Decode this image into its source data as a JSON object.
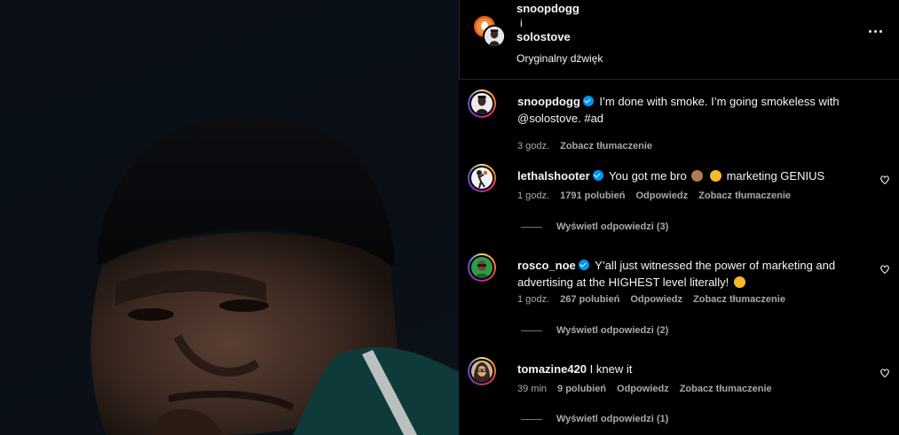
{
  "header": {
    "user1": "snoopdogg",
    "conjunction": "i",
    "user2": "solostove",
    "audio": "Oryginalny dźwięk"
  },
  "caption": {
    "username": "snoopdogg",
    "text": "I’m done with smoke. I’m going smokeless with @solostove. #ad",
    "time": "3 godz.",
    "translate": "Zobacz tłumaczenie"
  },
  "comments": [
    {
      "username": "lethalshooter",
      "text_before": "You got me bro",
      "text_after": "marketing GENIUS",
      "time": "1 godz.",
      "likes": "1791 polubień",
      "reply": "Odpowiedz",
      "translate": "Zobacz tłumaczenie",
      "view_replies": "Wyświetl odpowiedzi (3)"
    },
    {
      "username": "rosco_noe",
      "text": "Y’all just witnessed the power of marketing and advertising at the HIGHEST level literally!",
      "time": "1 godz.",
      "likes": "267 polubień",
      "reply": "Odpowiedz",
      "translate": "Zobacz tłumaczenie",
      "view_replies": "Wyświetl odpowiedzi (2)"
    },
    {
      "username": "tomazine420",
      "text": "I knew it",
      "time": "39 min",
      "likes": "9 polubień",
      "reply": "Odpowiedz",
      "translate": "Zobacz tłumaczenie",
      "view_replies": "Wyświetl odpowiedzi (1)"
    }
  ],
  "icons": {
    "more": "more-options-icon",
    "like": "heart-icon",
    "verified": "verified-badge-icon"
  },
  "colors": {
    "background": "#000000",
    "muted_text": "#a8a8a8",
    "verified": "#0095f6"
  }
}
